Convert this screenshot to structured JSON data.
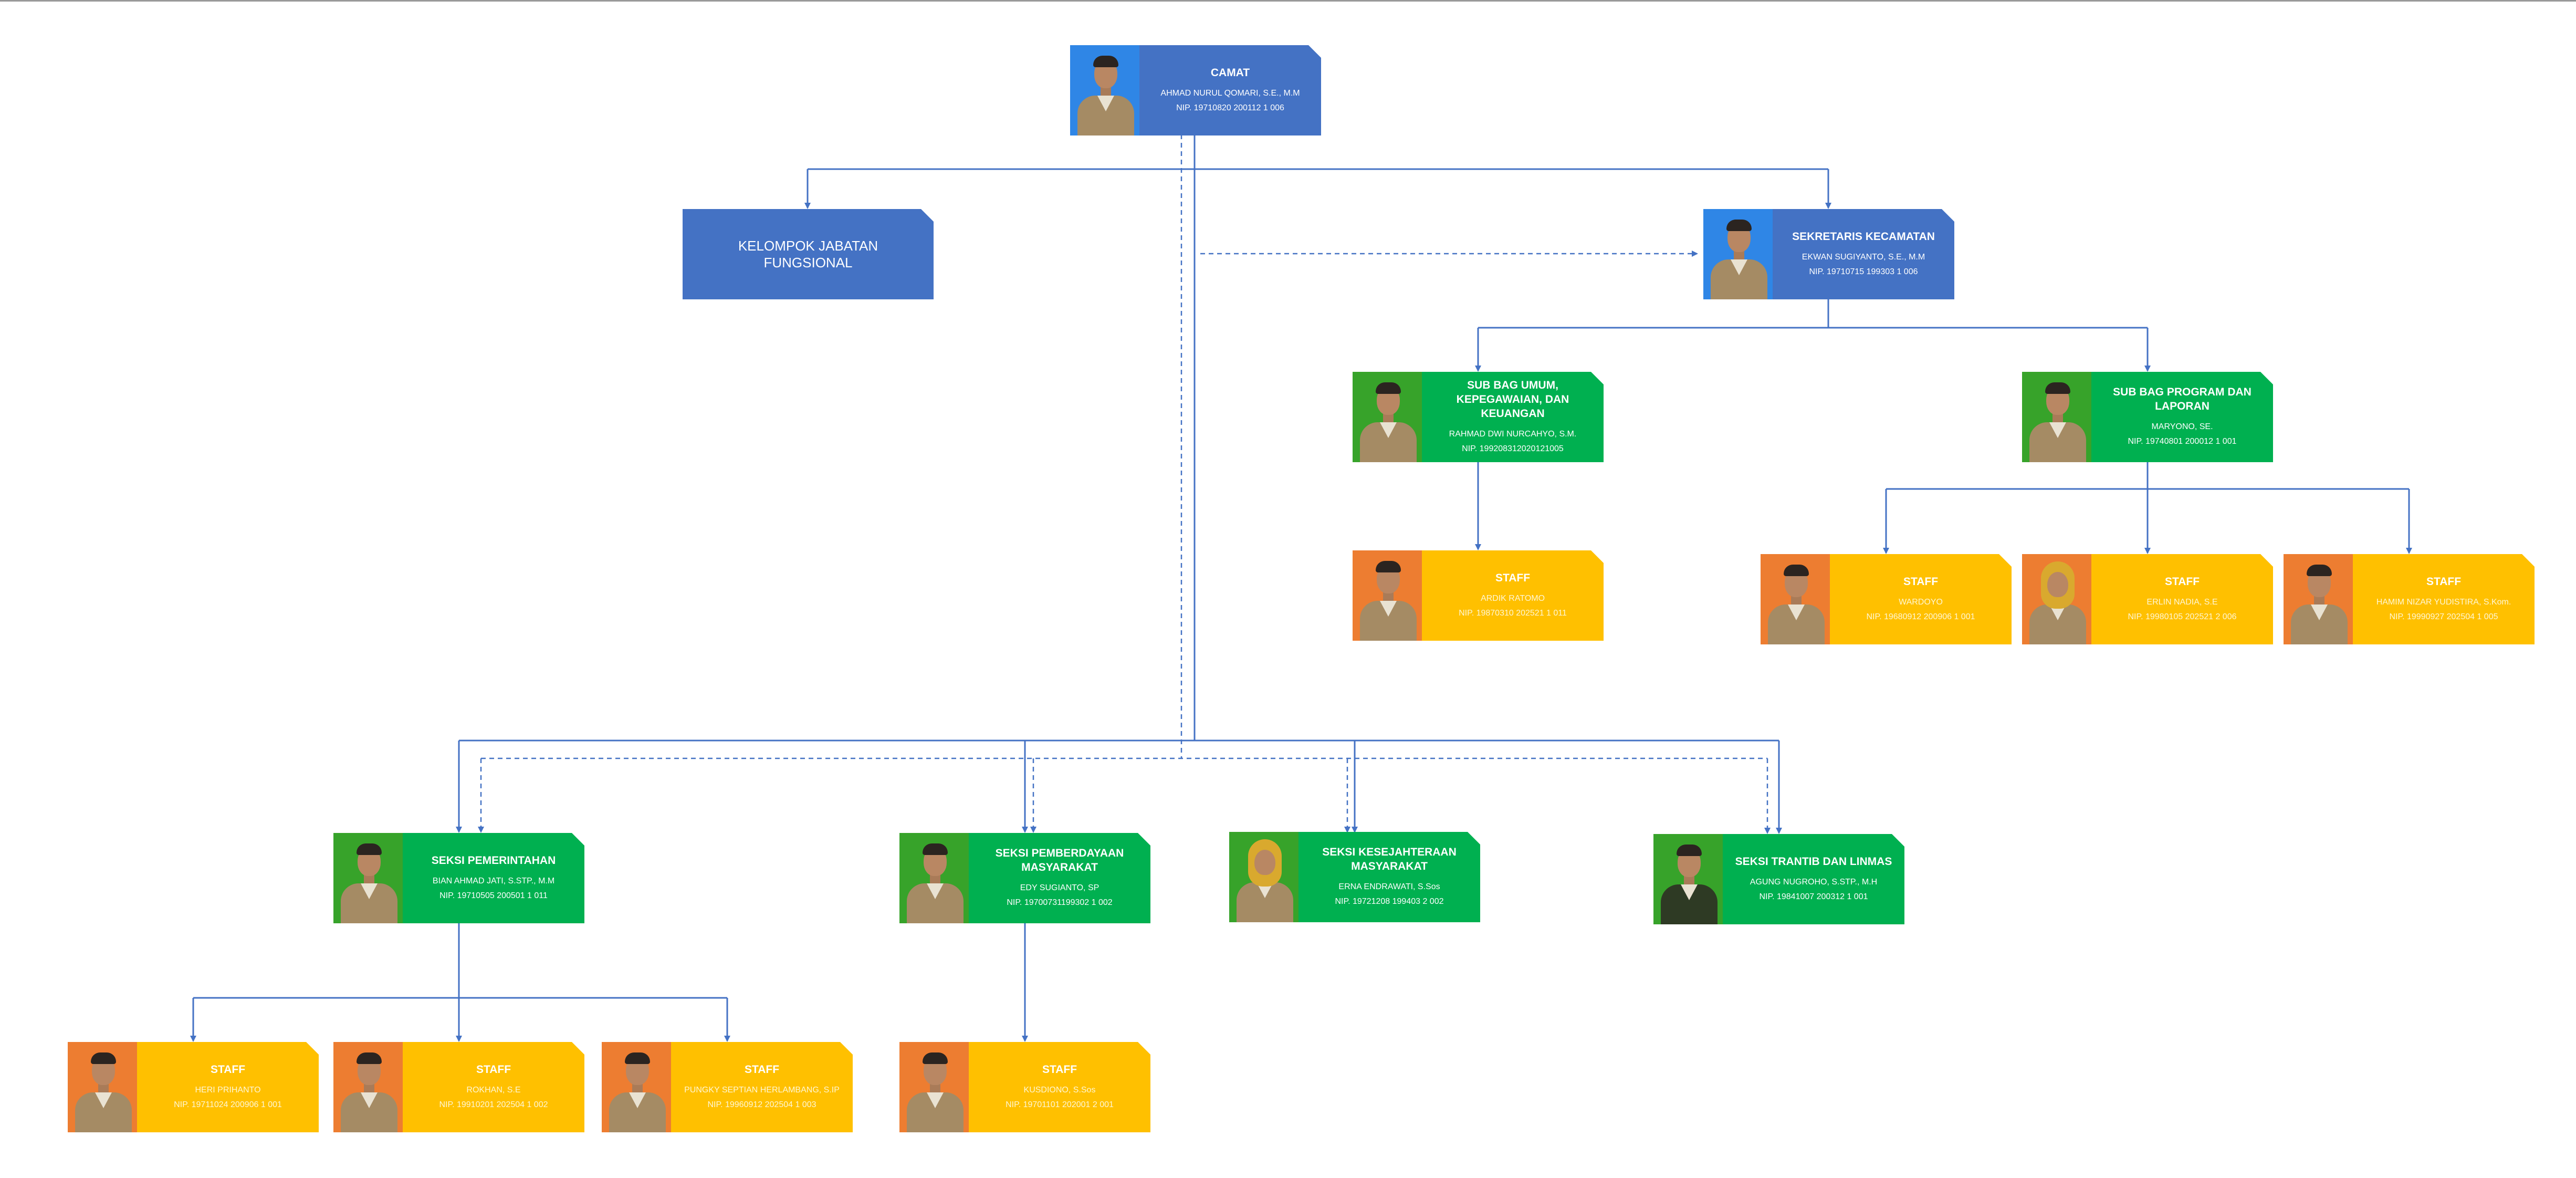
{
  "nodes": {
    "camat": {
      "title": "CAMAT",
      "name": "AHMAD NURUL QOMARI, S.E., M.M",
      "nip": "NIP. 19710820 200112 1 006"
    },
    "fungsional": {
      "title": "KELOMPOK JABATAN FUNGSIONAL"
    },
    "sekretaris": {
      "title": "SEKRETARIS KECAMATAN",
      "name": "EKWAN SUGIYANTO, S.E., M.M",
      "nip": "NIP. 19710715 199303 1 006"
    },
    "subbag_umum": {
      "title": "SUB BAG UMUM, KEPEGAWAIAN, DAN KEUANGAN",
      "name": "RAHMAD DWI NURCAHYO, S.M.",
      "nip": "NIP. 199208312020121005"
    },
    "subbag_program": {
      "title": "SUB BAG PROGRAM DAN LAPORAN",
      "name": "MARYONO, SE.",
      "nip": "NIP. 19740801 200012 1 001"
    },
    "staff_umum": {
      "title": "STAFF",
      "name": "ARDIK RATOMO",
      "nip": "NIP. 19870310 202521 1 011"
    },
    "staff_prog_1": {
      "title": "STAFF",
      "name": "WARDOYO",
      "nip": "NIP. 19680912 200906 1 001"
    },
    "staff_prog_2": {
      "title": "STAFF",
      "name": "ERLIN NADIA, S.E",
      "nip": "NIP. 19980105 202521 2 006"
    },
    "staff_prog_3": {
      "title": "STAFF",
      "name": "HAMIM NIZAR YUDISTIRA, S.Kom.",
      "nip": "NIP. 19990927 202504 1 005"
    },
    "seksi_pem": {
      "title": "SEKSI PEMERINTAHAN",
      "name": "BIAN AHMAD JATI, S.STP., M.M",
      "nip": "NIP. 19710505 200501 1 011"
    },
    "seksi_pmb": {
      "title": "SEKSI PEMBERDAYAAN MASYARAKAT",
      "name": "EDY SUGIANTO, SP",
      "nip": "NIP. 19700731199302 1 002"
    },
    "seksi_kes": {
      "title": "SEKSI KESEJAHTERAAN MASYARAKAT",
      "name": "ERNA ENDRAWATI, S.Sos",
      "nip": "NIP. 19721208 199403 2 002"
    },
    "seksi_trantib": {
      "title": "SEKSI TRANTIB DAN LINMAS",
      "name": "AGUNG NUGROHO, S.STP., M.H",
      "nip": "NIP. 19841007 200312 1 001"
    },
    "staff_pem_1": {
      "title": "STAFF",
      "name": "HERI PRIHANTO",
      "nip": "NIP. 19711024 200906 1 001"
    },
    "staff_pem_2": {
      "title": "STAFF",
      "name": "ROKHAN, S.E",
      "nip": "NIP. 19910201 202504 1 002"
    },
    "staff_pem_3": {
      "title": "STAFF",
      "name": "PUNGKY SEPTIAN HERLAMBANG, S.IP",
      "nip": "NIP. 19960912 202504 1 003"
    },
    "staff_pmb": {
      "title": "STAFF",
      "name": "KUSDIONO, S.Sos",
      "nip": "NIP. 19701101 202001 2 001"
    }
  },
  "colors": {
    "blue": "#4472c4",
    "green": "#00b050",
    "yellow": "#ffc000",
    "photo_orange": "#ed7d31",
    "line": "#4472c4"
  }
}
